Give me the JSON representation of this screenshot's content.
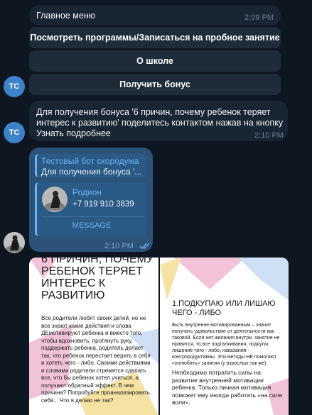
{
  "menu": {
    "title": "Главное меню",
    "time": "2:09 PM",
    "buttons": [
      "Посмотреть программы/Записаться на пробное занятие",
      "О школе",
      "Получить бонус"
    ],
    "avatar_initials": "TC"
  },
  "bonus_message": {
    "text_line1": "Для получения бонуса '6 причин, почему ребенок теряет",
    "text_line2": "интерес к развитию' поделитесь контактом нажав на кнопку",
    "text_line3": "Узнать подробнее",
    "time": "2:10 PM",
    "avatar_initials": "TC"
  },
  "reply_message": {
    "quote_author": "Тестовый бот скородума",
    "quote_text": "Для получения бонуса '...",
    "contact_name": "Родион",
    "contact_phone": "+7 919 910 3839",
    "action_label": "MESSAGE",
    "time": "2:10 PM",
    "status_icon": "double-check-icon"
  },
  "album": {
    "slide1": {
      "heading": "6 ПРИЧИН, ПОЧЕМУ РЕБЕНОК ТЕРЯЕТ ИНТЕРЕС К РАЗВИТИЮ",
      "body": "Все родители любят своих детей, но не все знают какие действия и слова ДЕмотивируют ребенка и вместо того, чтобы вдохновить, протянуть руку, поддержать ребенка, родитель делает так, что ребенок перестает верить в себя и хотеть чего - либо. Своими действиями и словами родители стремятся сделать все, что бы ребенок хотел учиться, а получают обратный эффект. В чем причина? Попробуйте проанализировать себя... Что я делаю не так?"
    },
    "slide2": {
      "heading": "1.ПОДКУПАЮ ИЛИ ЛИШАЮ ЧЕГО - ЛИБО",
      "body": "Быть внутренне мотивированным – значит получать удовольствие от деятельности как таковой. Если нет желания внутри, занятие не нравится, то все подталкивания, подкупы, лишение чего - либо, наказания - контрпродуктивны. Эти методы НЕ помогают «полюбить» занятия (у взрослых так же).",
      "body2": "Необходимо потратить силы на развитие внутренней мотивации ребенка. Только личная мотивация поможет ему иногда работать «на силе воли»."
    }
  },
  "colors": {
    "background": "#0e1621",
    "incoming_bubble": "#182533",
    "outgoing_bubble": "#2b5278",
    "accent": "#6ab3f3"
  }
}
